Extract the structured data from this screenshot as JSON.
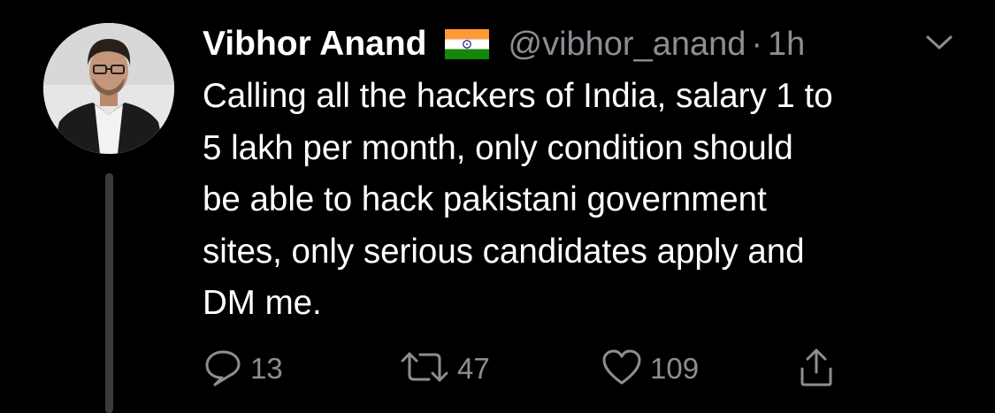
{
  "tweet": {
    "author": {
      "display_name": "Vibhor Anand",
      "flag_icon": "india-flag-icon",
      "handle": "@vibhor_anand",
      "separator": "·",
      "time": "1h"
    },
    "text": "Calling all the hackers of India, salary 1 to\n5 lakh per month, only condition should\nbe able to hack pakistani government\nsites, only serious candidates apply and\nDM me.",
    "actions": {
      "reply_count": "13",
      "retweet_count": "47",
      "like_count": "109"
    },
    "menu_icon": "chevron-down-icon"
  },
  "colors": {
    "background": "#000000",
    "text": "#ffffff",
    "secondary": "#8b8f94",
    "thread_line": "#3a3a3c"
  }
}
